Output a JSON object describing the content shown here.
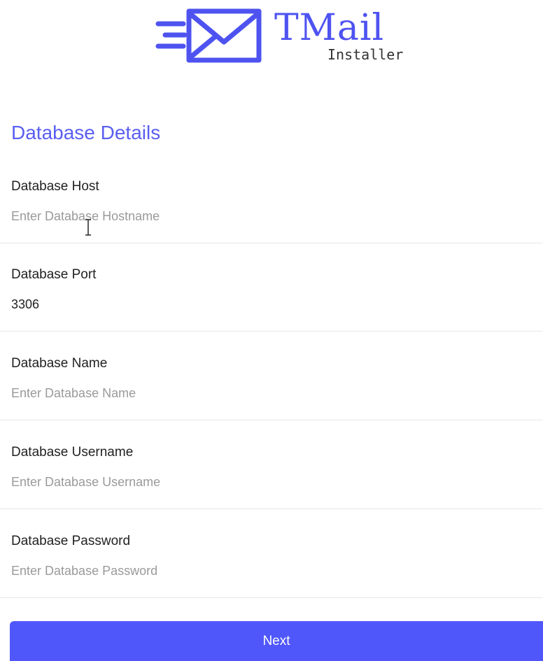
{
  "logo": {
    "brand": "TMail",
    "subtitle": "Installer",
    "icon": "envelope-speed-icon",
    "color": "#4e53f0"
  },
  "section_title": "Database Details",
  "fields": [
    {
      "label": "Database Host",
      "value": "",
      "placeholder": "Enter Database Hostname"
    },
    {
      "label": "Database Port",
      "value": "3306",
      "placeholder": ""
    },
    {
      "label": "Database Name",
      "value": "",
      "placeholder": "Enter Database Name"
    },
    {
      "label": "Database Username",
      "value": "",
      "placeholder": "Enter Database Username"
    },
    {
      "label": "Database Password",
      "value": "",
      "placeholder": "Enter Database Password"
    }
  ],
  "next_label": "Next",
  "colors": {
    "accent": "#4f57fb",
    "title": "#5a5ff0",
    "placeholder": "#9a9a9a"
  }
}
